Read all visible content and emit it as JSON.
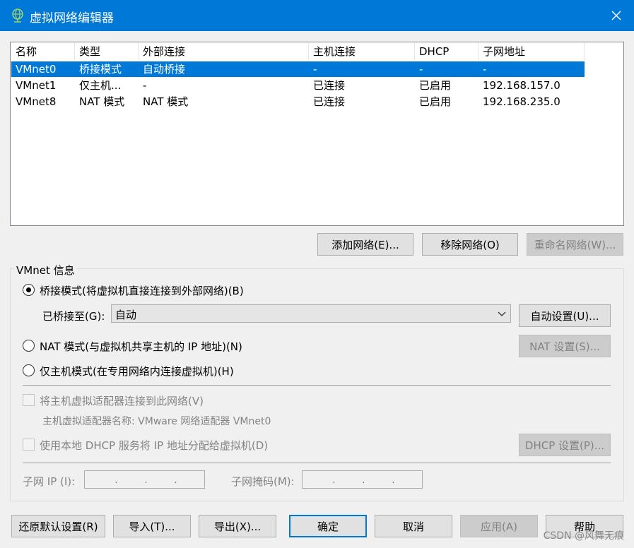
{
  "window": {
    "title": "虚拟网络编辑器",
    "icon": "network-globe-icon",
    "close_icon": "close-icon"
  },
  "network_list": {
    "columns": [
      "名称",
      "类型",
      "外部连接",
      "主机连接",
      "DHCP",
      "子网地址"
    ],
    "rows": [
      [
        "VMnet0",
        "桥接模式",
        "自动桥接",
        "-",
        "-",
        "-"
      ],
      [
        "VMnet1",
        "仅主机...",
        "-",
        "已连接",
        "已启用",
        "192.168.157.0"
      ],
      [
        "VMnet8",
        "NAT 模式",
        "NAT 模式",
        "已连接",
        "已启用",
        "192.168.235.0"
      ]
    ],
    "selected_row": 0
  },
  "list_buttons": {
    "add": "添加网络(E)...",
    "remove": "移除网络(O)",
    "rename": "重命名网络(W)..."
  },
  "vmnet_info": {
    "group_label": "VMnet 信息",
    "bridged_label": "桥接模式(将虚拟机直接连接到外部网络)(B)",
    "bridged_to_label": "已桥接至(G):",
    "bridged_to_value": "自动",
    "auto_settings": "自动设置(U)...",
    "nat_label": "NAT 模式(与虚拟机共享主机的 IP 地址)(N)",
    "nat_settings": "NAT 设置(S)...",
    "hostonly_label": "仅主机模式(在专用网络内连接虚拟机)(H)",
    "connect_adapter_label": "将主机虚拟适配器连接到此网络(V)",
    "adapter_name_label": "主机虚拟适配器名称: VMware 网络适配器 VMnet0",
    "dhcp_label": "使用本地 DHCP 服务将 IP 地址分配给虚拟机(D)",
    "dhcp_settings": "DHCP 设置(P)...",
    "subnet_ip_label": "子网 IP (I):",
    "subnet_mask_label": "子网掩码(M):",
    "selected_mode": "bridged"
  },
  "footer": {
    "restore": "还原默认设置(R)",
    "import": "导入(T)...",
    "export": "导出(X)...",
    "ok": "确定",
    "cancel": "取消",
    "apply": "应用(A)",
    "help": "帮助"
  },
  "watermark": "CSDN @风舞无痕",
  "colors": {
    "accent": "#0078d7",
    "disabled_text": "#838383"
  }
}
